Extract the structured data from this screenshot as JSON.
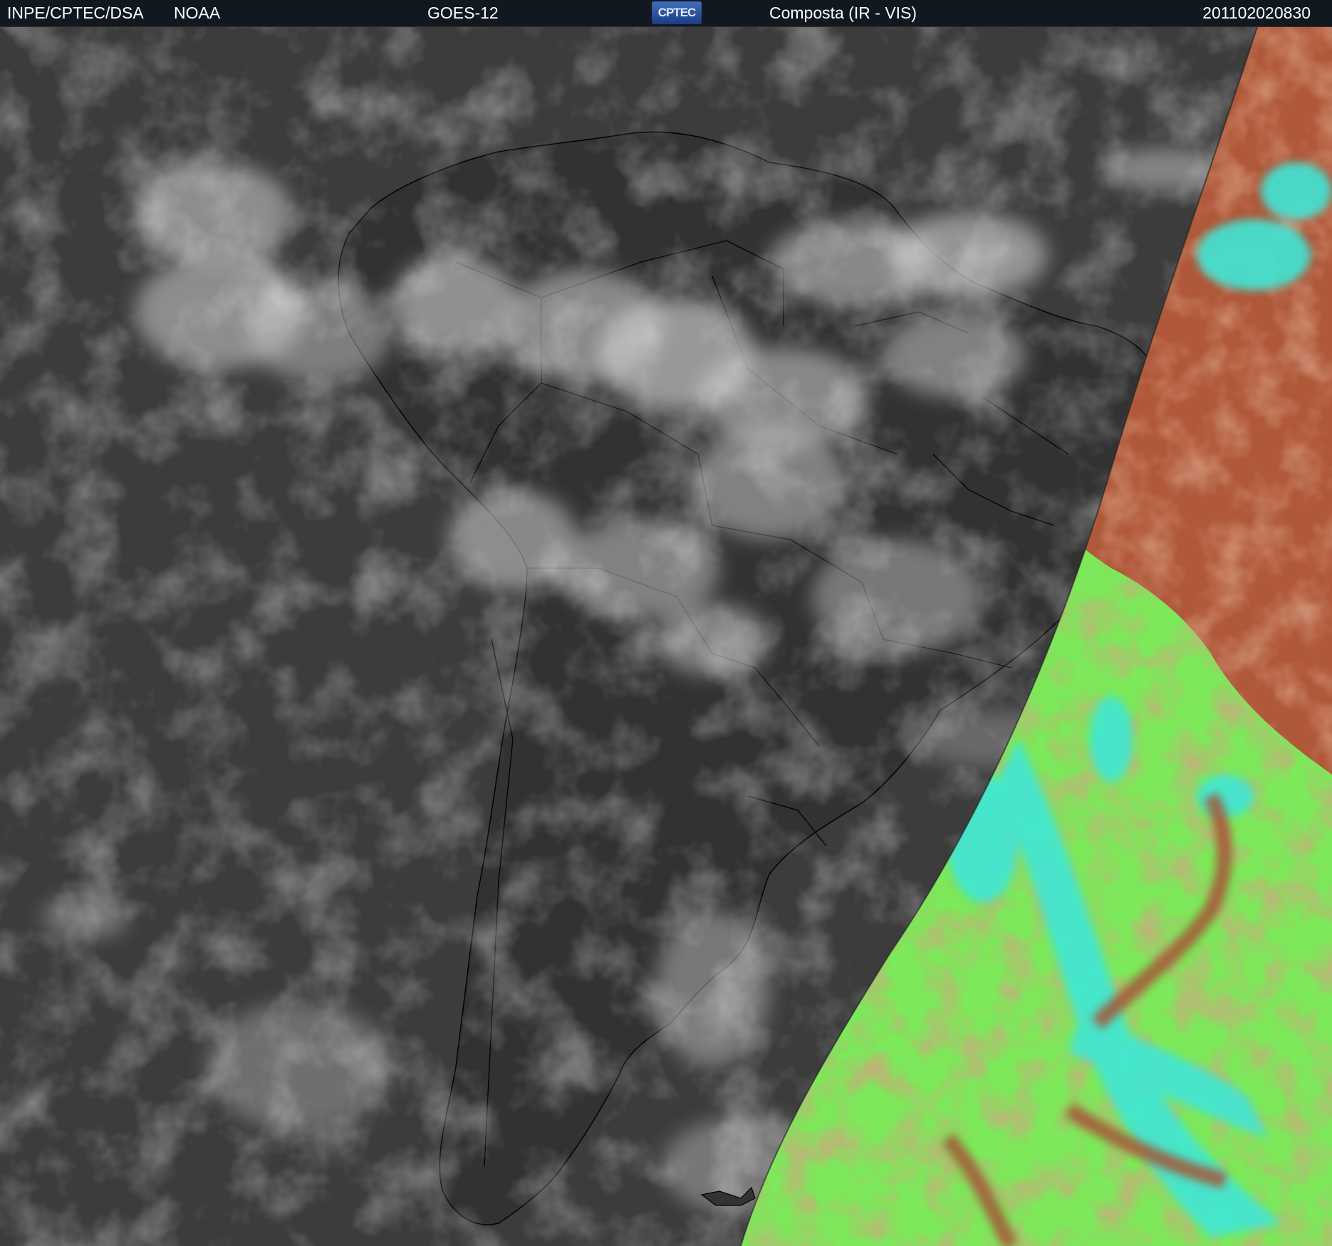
{
  "header": {
    "org": "INPE/CPTEC/DSA",
    "agency": "NOAA",
    "satellite": "GOES-12",
    "logo_text": "CPTEC",
    "product": "Composta (IR - VIS)",
    "timestamp": "201102020830"
  },
  "map": {
    "region": "South America",
    "night_side": "infrared grayscale",
    "day_side": "visible false-color composite",
    "colors": {
      "ocean_ir": "#3c3c3c",
      "land_ir": "#2f2f2f",
      "cloud_ir": "#d8d8d8",
      "border_line": "#000000",
      "vis_green": "#7de85a",
      "vis_cyan": "#3fe6d6",
      "vis_brown": "#b0583a",
      "header_bg": "#111820"
    }
  }
}
